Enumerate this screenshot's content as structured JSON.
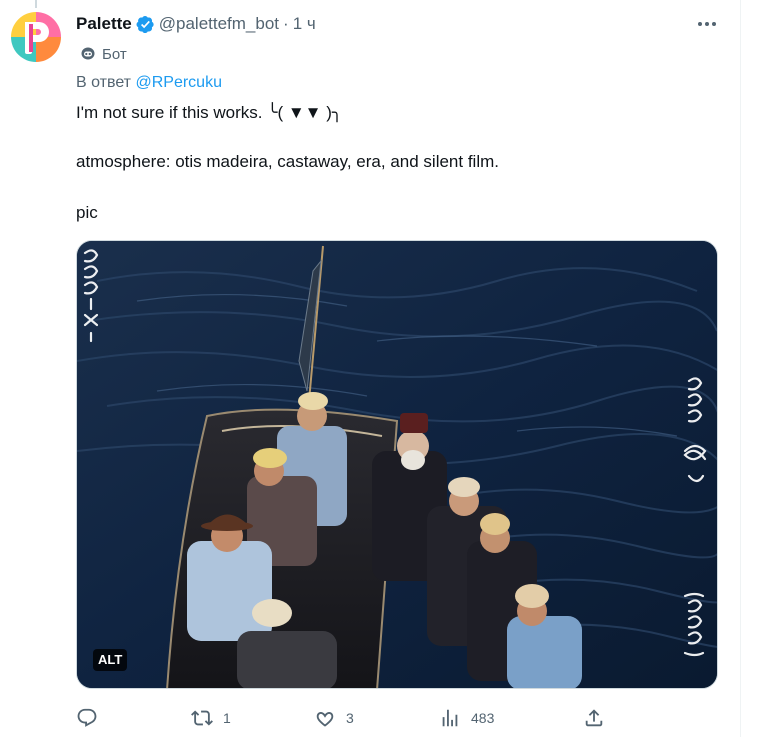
{
  "tweet": {
    "author_name": "Palette",
    "author_handle": "@palettefm_bot",
    "separator": "·",
    "time": "1 ч",
    "bot_label": "Бот",
    "reply_prefix": "В ответ",
    "reply_mention": "@RPercuku",
    "lines": [
      "I'm not sure if this works. ╰( ▼▼ )╮",
      "atmosphere: otis madeira, castaway, era, and silent film.",
      "pic"
    ],
    "alt_badge": "ALT"
  },
  "actions": {
    "replies": "",
    "retweets": "1",
    "likes": "3",
    "views": "483"
  },
  "photo": {
    "left_edge_marks": "333-15.X.31",
    "right_edge_marks": "333"
  },
  "icons": {
    "more": "more-horizontal-icon",
    "verified": "verified-badge-icon",
    "bot": "bot-icon",
    "reply": "reply-icon",
    "retweet": "retweet-icon",
    "like": "like-icon",
    "views": "views-icon",
    "share": "share-icon"
  },
  "colors": {
    "text_primary": "#0f1419",
    "text_secondary": "#536471",
    "link": "#1d9bf0",
    "verified": "#1d9bf0",
    "border": "#cfd9de"
  }
}
